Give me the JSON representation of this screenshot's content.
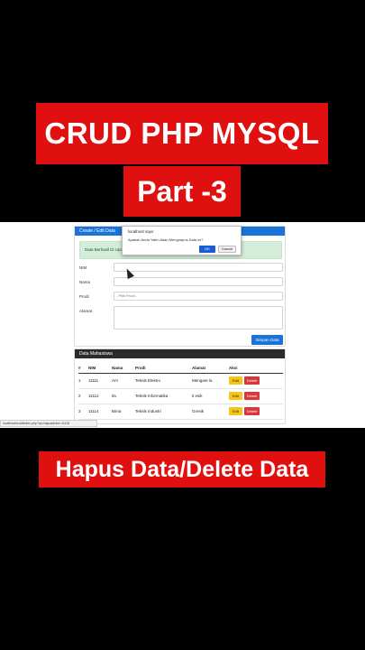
{
  "overlay": {
    "title_line1": "CRUD  PHP MYSQL",
    "title_line2": "Part -3",
    "subtitle": "Hapus Data/Delete Data"
  },
  "form_card": {
    "header": "Create / Edit Data",
    "alert": "Data Berhasil Di Upd...",
    "fields": {
      "nim_label": "NIM",
      "nama_label": "Nama",
      "prodi_label": "Prodi",
      "prodi_value": "- Pilih Prodi -",
      "alamat_label": "Alamat"
    },
    "save_label": "Simpan Data"
  },
  "table_card": {
    "header": "Data Mahasiswa",
    "columns": [
      "#",
      "NIM",
      "Nama",
      "Prodi",
      "Alamat",
      "Aksi"
    ],
    "rows": [
      {
        "no": "1",
        "nim": "11111",
        "nama": "Arri",
        "prodi": "Teknik Elektro",
        "alamat": "Mengare la"
      },
      {
        "no": "2",
        "nim": "11112",
        "nama": "Ila",
        "prodi": "Teknik Informatika",
        "alamat": "ti esik"
      },
      {
        "no": "3",
        "nim": "11114",
        "nama": "Bima",
        "prodi": "Teknik Industri",
        "alamat": "Gresik"
      }
    ],
    "edit_label": "Edit",
    "delete_label": "Delete"
  },
  "dialog": {
    "title": "localhost says",
    "message": "Apakah Anda Yakin Akan Menghapus Data ini?",
    "ok_label": "OK",
    "cancel_label": "Cancel"
  },
  "status_url": "localhost/crud/index.php?op=hapus&nim=11116",
  "colors": {
    "banner": "#e01010",
    "primary": "#1a73d9",
    "edit": "#f5c518",
    "delete": "#d9363e",
    "table_header": "#2b2b2b",
    "alert_bg": "#d4edda"
  }
}
